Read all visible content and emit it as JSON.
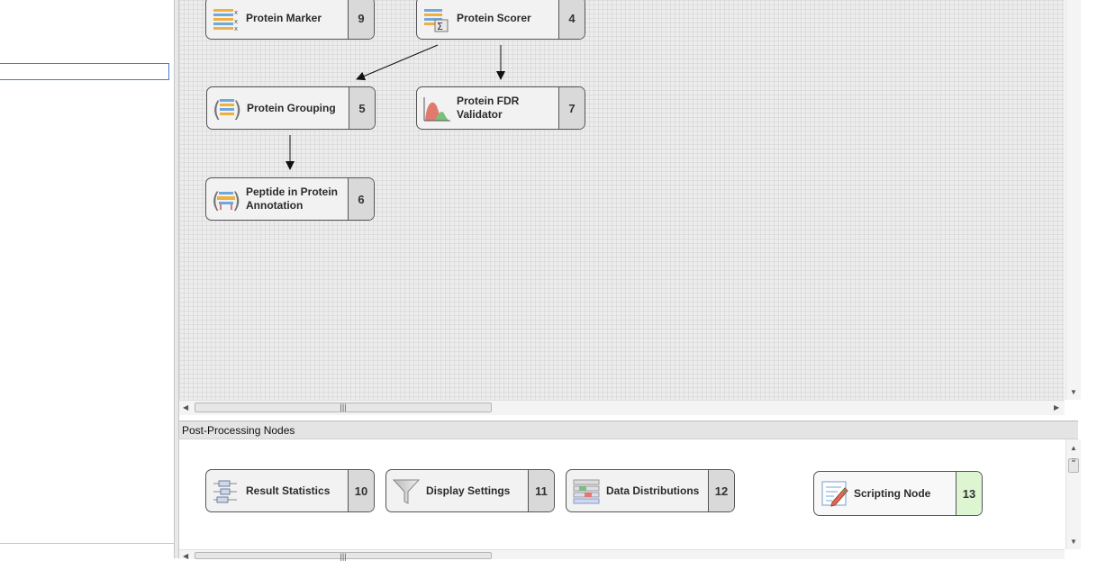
{
  "workflow": {
    "nodes": [
      {
        "label": "Protein Marker",
        "num": "9",
        "icon": "protein-marker-icon"
      },
      {
        "label": "Protein Scorer",
        "num": "4",
        "icon": "protein-scorer-icon"
      },
      {
        "label": "Protein Grouping",
        "num": "5",
        "icon": "protein-grouping-icon"
      },
      {
        "label": "Protein FDR Validator",
        "num": "7",
        "icon": "fdr-validator-icon"
      },
      {
        "label": "Peptide in Protein Annotation",
        "num": "6",
        "icon": "peptide-annotation-icon"
      }
    ]
  },
  "post_processing": {
    "title": "Post-Processing Nodes",
    "nodes": [
      {
        "label": "Result Statistics",
        "num": "10",
        "icon": "result-statistics-icon"
      },
      {
        "label": "Display Settings",
        "num": "11",
        "icon": "funnel-icon"
      },
      {
        "label": "Data Distributions",
        "num": "12",
        "icon": "data-distributions-icon"
      },
      {
        "label": "Scripting Node",
        "num": "13",
        "icon": "scripting-icon"
      }
    ]
  },
  "colors": {
    "highlight_num": "#ddf5d0",
    "selection_border": "#4a7cc0"
  }
}
